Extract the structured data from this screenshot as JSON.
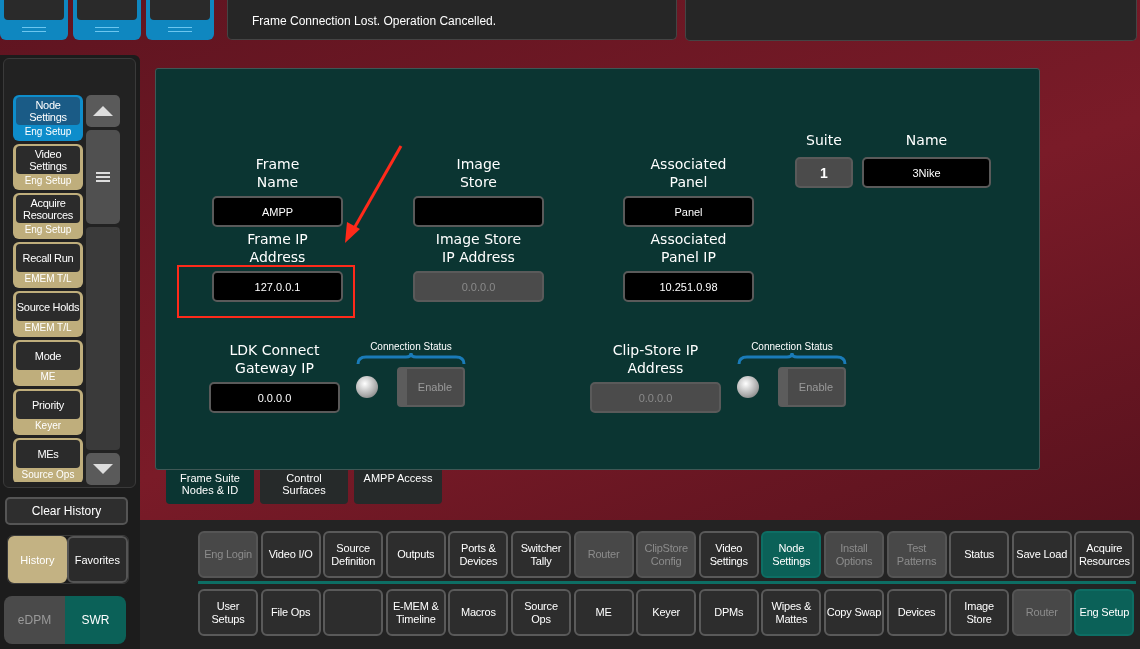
{
  "top_bar": {
    "message": "Frame Connection Lost. Operation Cancelled."
  },
  "history": {
    "items": [
      {
        "label": "Node Settings",
        "sublabel": "Eng Setup",
        "selected": true
      },
      {
        "label": "Video Settings",
        "sublabel": "Eng Setup",
        "selected": false
      },
      {
        "label": "Acquire Resources",
        "sublabel": "Eng Setup",
        "selected": false
      },
      {
        "label": "Recall Run",
        "sublabel": "EMEM T/L",
        "selected": false
      },
      {
        "label": "Source Holds",
        "sublabel": "EMEM T/L",
        "selected": false
      },
      {
        "label": "Mode",
        "sublabel": "ME",
        "selected": false
      },
      {
        "label": "Priority",
        "sublabel": "Keyer",
        "selected": false
      },
      {
        "label": "MEs",
        "sublabel": "Source Ops",
        "selected": false
      }
    ],
    "clear_button": "Clear History",
    "view_tabs": [
      {
        "label": "History",
        "selected": true
      },
      {
        "label": "Favorites",
        "selected": false
      }
    ],
    "mode_tabs": [
      {
        "label": "eDPM",
        "selected": false
      },
      {
        "label": "SWR",
        "selected": true
      }
    ]
  },
  "panel": {
    "columns": [
      {
        "fields": [
          {
            "label": "Frame\nName",
            "value": "AMPP",
            "disabled": false
          },
          {
            "label": "Frame IP\nAddress",
            "value": "127.0.0.1",
            "disabled": false
          }
        ]
      },
      {
        "fields": [
          {
            "label": "Image\nStore",
            "disabled": false
          },
          {
            "label": "Image Store\nIP Address",
            "value": "0.0.0.0",
            "disabled": true
          }
        ]
      },
      {
        "fields": [
          {
            "label": "Associated\nPanel",
            "value": "Panel",
            "disabled": false
          },
          {
            "label": "Associated\nPanel IP",
            "value": "10.251.0.98",
            "disabled": false
          }
        ]
      }
    ],
    "suite": {
      "label": "Suite",
      "value": "1"
    },
    "name": {
      "label": "Name",
      "value": "3Nike"
    },
    "gateways": [
      {
        "label": "LDK Connect\nGateway IP",
        "value": "0.0.0.0",
        "disabled": false,
        "status": {
          "caption": "Connection Status",
          "connected": false,
          "button": "Enable",
          "button_disabled": true
        }
      },
      {
        "label": "Clip-Store IP\nAddress",
        "value": "0.0.0.0",
        "disabled": true,
        "status": {
          "caption": "Connection Status",
          "connected": false,
          "button": "Enable",
          "button_disabled": true
        }
      }
    ]
  },
  "tabs": [
    {
      "label": "Frame Suite\nNodes & ID",
      "selected": true
    },
    {
      "label": "Control\nSurfaces",
      "selected": false
    },
    {
      "label": "AMPP Access",
      "selected": false
    }
  ],
  "dock": {
    "rows": [
      [
        {
          "label": "Eng Login",
          "selected": false,
          "disabled": true
        },
        {
          "label": "Video I/O",
          "selected": false,
          "disabled": false
        },
        {
          "label": "Source Definition",
          "selected": false,
          "disabled": false
        },
        {
          "label": "Outputs",
          "selected": false,
          "disabled": false
        },
        {
          "label": "Ports & Devices",
          "selected": false,
          "disabled": false
        },
        {
          "label": "Switcher Tally",
          "selected": false,
          "disabled": false
        },
        {
          "label": "Router",
          "selected": false,
          "disabled": true
        },
        {
          "label": "ClipStore Config",
          "selected": false,
          "disabled": true
        },
        {
          "label": "Video Settings",
          "selected": false,
          "disabled": false
        },
        {
          "label": "Node Settings",
          "selected": true,
          "disabled": false
        },
        {
          "label": "Install Options",
          "selected": false,
          "disabled": true
        },
        {
          "label": "Test Patterns",
          "selected": false,
          "disabled": true
        },
        {
          "label": "Status",
          "selected": false,
          "disabled": false
        },
        {
          "label": "Save Load",
          "selected": false,
          "disabled": false
        },
        {
          "label": "Acquire Resources",
          "selected": false,
          "disabled": false
        }
      ],
      [
        {
          "label": "User Setups",
          "selected": false,
          "disabled": false
        },
        {
          "label": "File Ops",
          "selected": false,
          "disabled": false
        },
        {
          "selected": false,
          "disabled": false
        },
        {
          "label": "E-MEM & Timeline",
          "selected": false,
          "disabled": false
        },
        {
          "label": "Macros",
          "selected": false,
          "disabled": false
        },
        {
          "label": "Source Ops",
          "selected": false,
          "disabled": false
        },
        {
          "label": "ME",
          "selected": false,
          "disabled": false
        },
        {
          "label": "Keyer",
          "selected": false,
          "disabled": false
        },
        {
          "label": "DPMs",
          "selected": false,
          "disabled": false
        },
        {
          "label": "Wipes & Mattes",
          "selected": false,
          "disabled": false
        },
        {
          "label": "Copy Swap",
          "selected": false,
          "disabled": false
        },
        {
          "label": "Devices",
          "selected": false,
          "disabled": false
        },
        {
          "label": "Image Store",
          "selected": false,
          "disabled": false
        },
        {
          "label": "Router",
          "selected": false,
          "disabled": true
        },
        {
          "label": "Eng Setup",
          "selected": true,
          "disabled": false
        }
      ]
    ]
  }
}
